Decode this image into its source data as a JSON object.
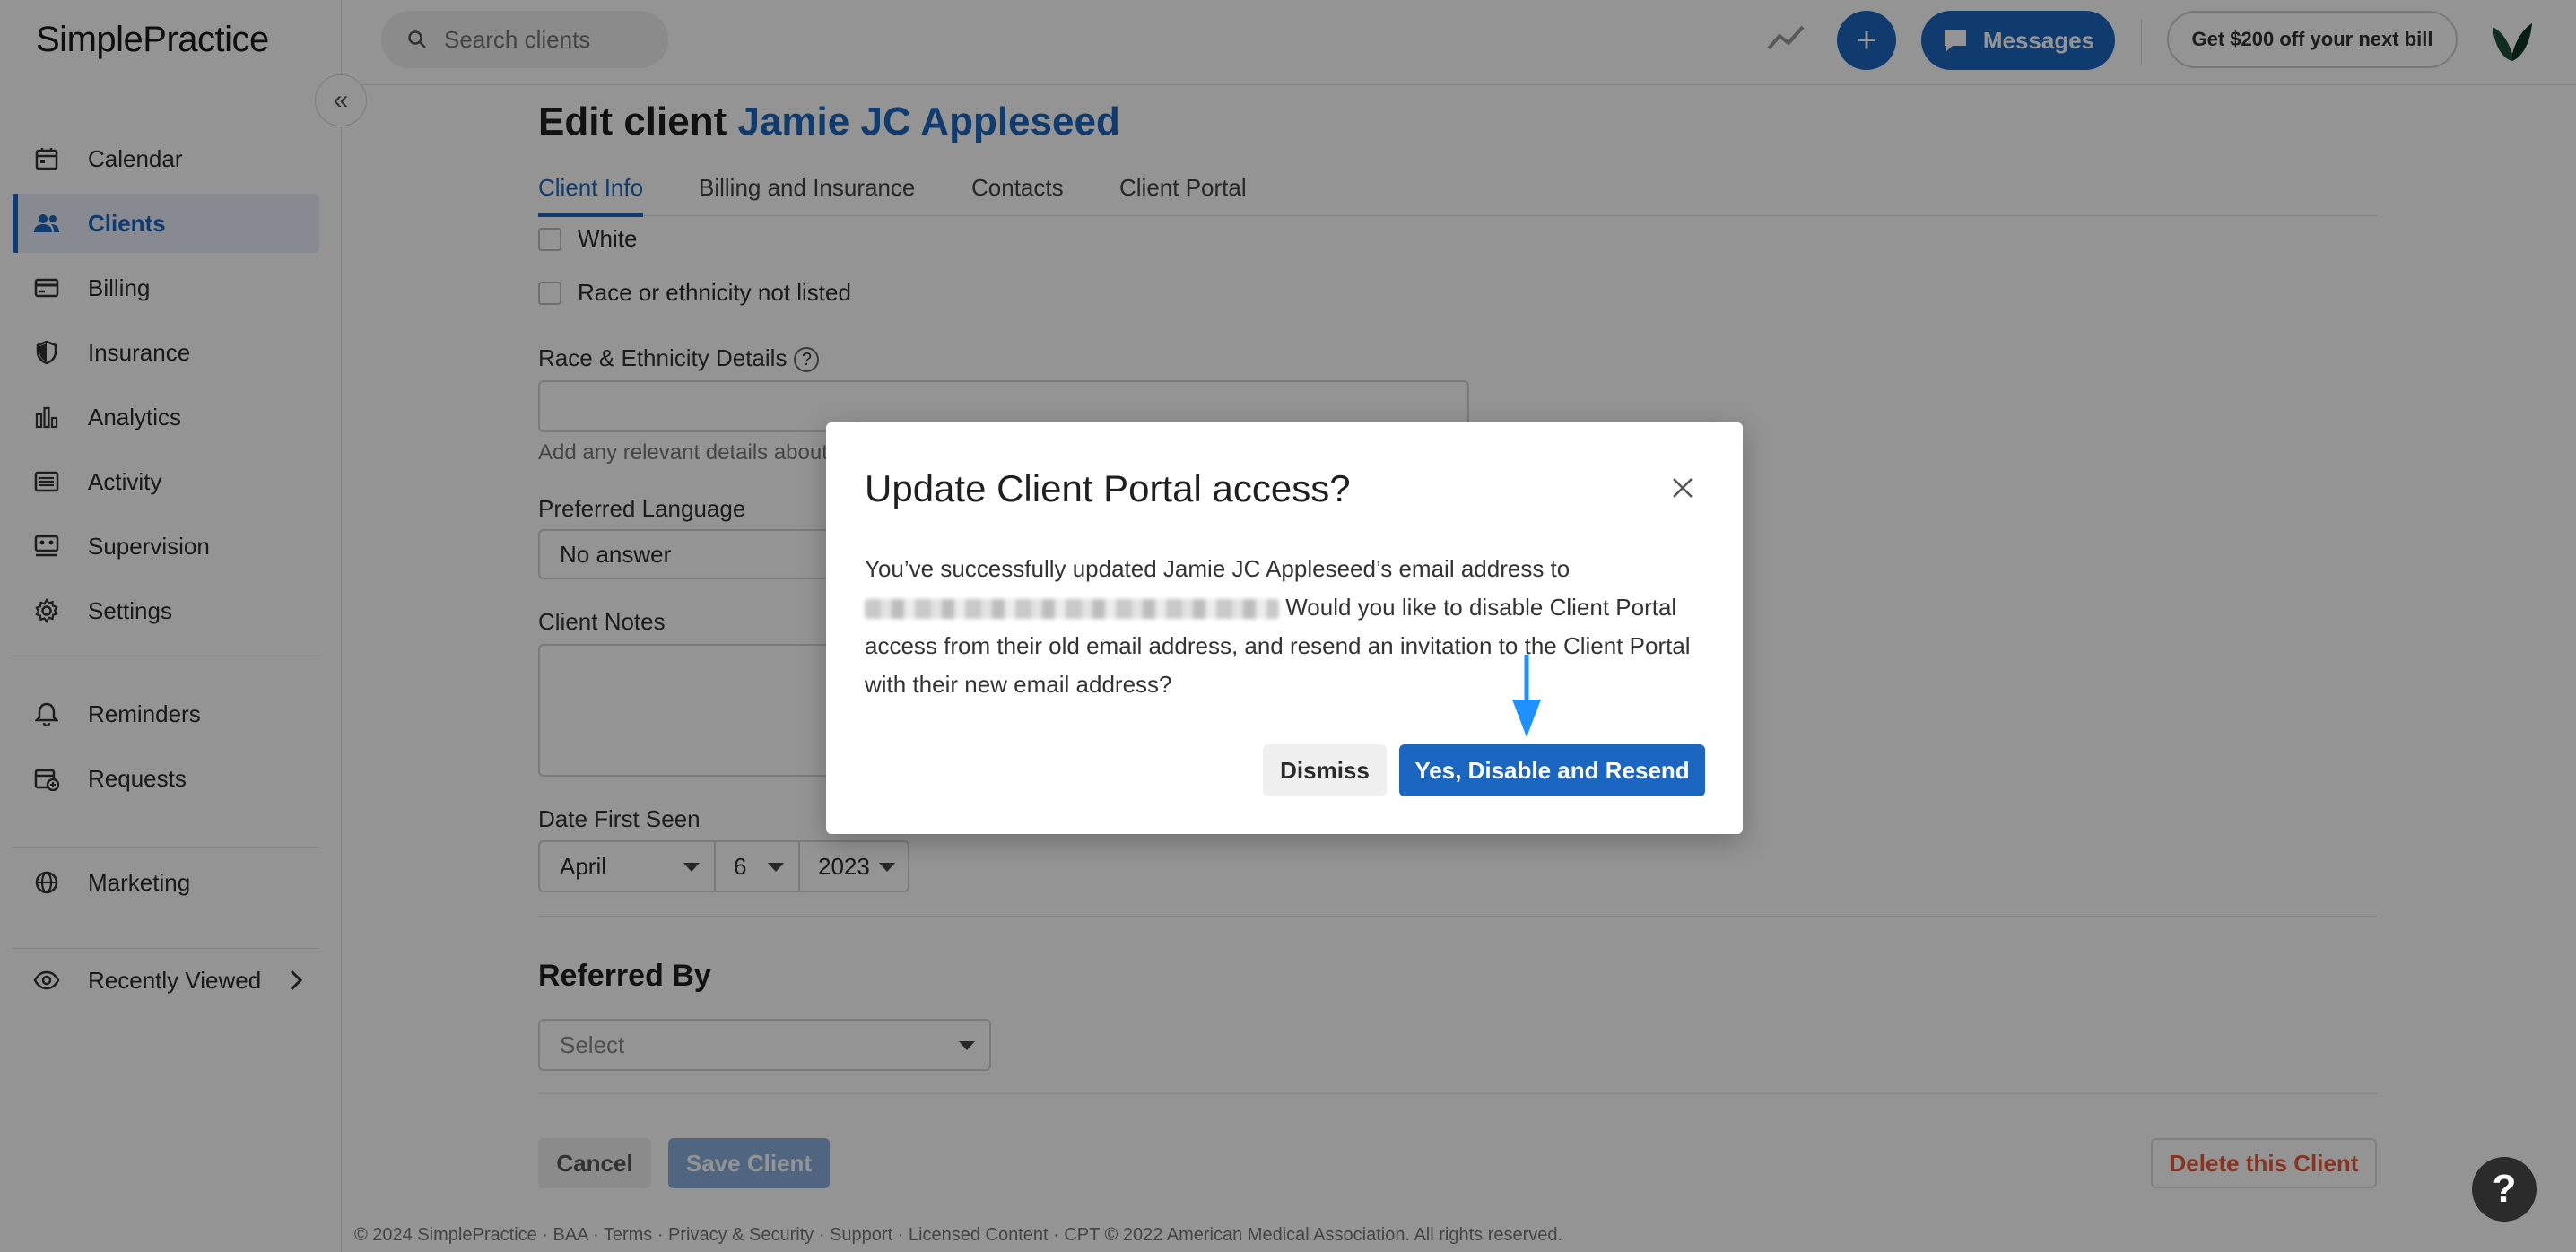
{
  "app": {
    "logo_text": "SimplePractice"
  },
  "sidebar": {
    "collapse_icon": "«",
    "items": [
      {
        "label": "Calendar",
        "icon": "calendar-icon"
      },
      {
        "label": "Clients",
        "icon": "users-icon",
        "active": true
      },
      {
        "label": "Billing",
        "icon": "credit-card-icon"
      },
      {
        "label": "Insurance",
        "icon": "shield-icon"
      },
      {
        "label": "Analytics",
        "icon": "bar-chart-icon"
      },
      {
        "label": "Activity",
        "icon": "list-icon"
      },
      {
        "label": "Supervision",
        "icon": "supervision-icon"
      },
      {
        "label": "Settings",
        "icon": "gear-icon"
      },
      {
        "label": "Reminders",
        "icon": "bell-icon"
      },
      {
        "label": "Requests",
        "icon": "calendar-plus-icon"
      },
      {
        "label": "Marketing",
        "icon": "globe-icon"
      },
      {
        "label": "Recently Viewed",
        "icon": "eye-icon"
      }
    ]
  },
  "topbar": {
    "search_placeholder": "Search clients",
    "add_label": "+",
    "messages_label": "Messages",
    "promo_label": "Get $200 off your next bill"
  },
  "page": {
    "title_prefix": "Edit client",
    "client_name": "Jamie JC Appleseed",
    "tabs": [
      "Client Info",
      "Billing and Insurance",
      "Contacts",
      "Client Portal"
    ],
    "active_tab": "Client Info"
  },
  "form": {
    "race_options": [
      "White",
      "Race or ethnicity not listed"
    ],
    "race_details_label": "Race & Ethnicity Details",
    "race_details_hint": "Add any relevant details about the client's race or ethnicity",
    "preferred_language_label": "Preferred Language",
    "preferred_language_value": "No answer",
    "client_notes_label": "Client Notes",
    "date_first_seen_label": "Date First Seen",
    "date_month": "April",
    "date_day": "6",
    "date_year": "2023",
    "referred_by_title": "Referred By",
    "referred_by_placeholder": "Select",
    "cancel_label": "Cancel",
    "save_label": "Save Client",
    "delete_label": "Delete this Client"
  },
  "footer": {
    "text": "© 2024 SimplePractice · BAA · Terms · Privacy & Security · Support · Licensed Content · CPT © 2022 American Medical Association. All rights reserved."
  },
  "help_fab_label": "?",
  "modal": {
    "title": "Update Client Portal access?",
    "body_before": "You’ve successfully updated Jamie JC Appleseed’s email address to",
    "body_after": "Would you like to disable Client Portal access from their old email address, and resend an invitation to the Client Portal with their new email address?",
    "dismiss_label": "Dismiss",
    "confirm_label": "Yes, Disable and Resend"
  },
  "colors": {
    "accent": "#1a66c0",
    "annotation_arrow": "#1e90ff",
    "delete": "#e8593c"
  }
}
